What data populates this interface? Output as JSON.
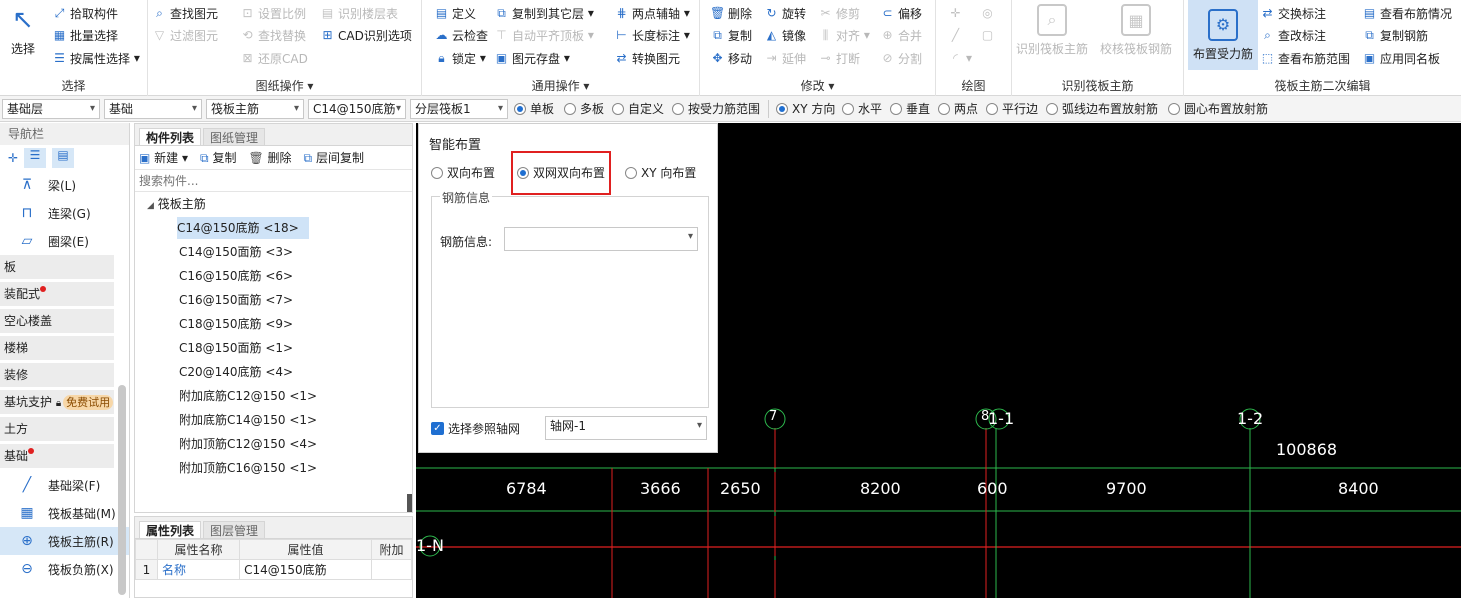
{
  "ribbon": {
    "select": {
      "label": "选择",
      "items": [
        "拾取构件",
        "批量选择",
        "按属性选择"
      ],
      "group": "选择"
    },
    "drawing": {
      "col1": [
        "查找图元",
        "过滤图元"
      ],
      "col2": [
        "设置比例",
        "查找替换",
        "还原CAD"
      ],
      "col3": [
        "识别楼层表",
        "CAD识别选项"
      ],
      "group": "图纸操作"
    },
    "general": {
      "col1": [
        "定义",
        "云检查",
        "锁定"
      ],
      "col2": [
        "复制到其它层",
        "自动平齐顶板",
        "图元存盘"
      ],
      "col3": [
        "两点辅轴",
        "长度标注",
        "转换图元"
      ],
      "group": "通用操作"
    },
    "modify": {
      "col1": [
        "删除",
        "复制",
        "移动"
      ],
      "col2": [
        "旋转",
        "镜像",
        "延伸"
      ],
      "col3": [
        "修剪",
        "对齐",
        "打断"
      ],
      "col4": [
        "偏移",
        "合并",
        "分割"
      ],
      "group": "修改"
    },
    "draw": {
      "group": "绘图"
    },
    "recog": {
      "btn1": "识别筏板主筋",
      "btn2": "校核筏板钢筋",
      "group": "识别筏板主筋"
    },
    "edit2": {
      "big": "布置受力筋",
      "col1": [
        "交换标注",
        "查改标注",
        "查看布筋范围"
      ],
      "col2": [
        "查看布筋情况",
        "复制钢筋",
        "应用同名板"
      ],
      "group": "筏板主筋二次编辑"
    }
  },
  "toolbar": {
    "selects": [
      "基础层",
      "基础",
      "筏板主筋",
      "C14@150底筋",
      "分层筏板1"
    ],
    "radios1": [
      "单板",
      "多板",
      "自定义",
      "按受力筋范围"
    ],
    "radios2": [
      "XY 方向",
      "水平",
      "垂直",
      "两点",
      "平行边",
      "弧线边布置放射筋",
      "圆心布置放射筋"
    ]
  },
  "nav": {
    "title": "导航栏",
    "top_items": [
      {
        "label": "梁(L)"
      },
      {
        "label": "连梁(G)"
      },
      {
        "label": "圈梁(E)"
      }
    ],
    "cats": [
      "板",
      "装配式",
      "空心楼盖",
      "楼梯",
      "装修",
      "基坑支护",
      "土方",
      "基础"
    ],
    "trial_badge": "免费试用",
    "bottom_items": [
      {
        "label": "基础梁(F)"
      },
      {
        "label": "筏板基础(M)"
      },
      {
        "label": "筏板主筋(R)"
      },
      {
        "label": "筏板负筋(X)"
      }
    ]
  },
  "comp": {
    "tabs": [
      "构件列表",
      "图纸管理"
    ],
    "actions": [
      "新建",
      "复制",
      "删除",
      "层间复制"
    ],
    "search_placeholder": "搜索构件...",
    "root": "筏板主筋",
    "items": [
      "C14@150底筋 <18>",
      "C14@150面筋 <3>",
      "C16@150底筋 <6>",
      "C16@150面筋 <7>",
      "C18@150底筋 <9>",
      "C18@150面筋 <1>",
      "C20@140底筋 <4>",
      "附加底筋C12@150 <1>",
      "附加底筋C14@150 <1>",
      "附加顶筋C12@150 <4>",
      "附加顶筋C16@150 <1>"
    ]
  },
  "prop": {
    "tabs": [
      "属性列表",
      "图层管理"
    ],
    "headers": [
      "属性名称",
      "属性值",
      "附加"
    ],
    "row": {
      "num": "1",
      "name": "名称",
      "value": "C14@150底筋"
    }
  },
  "dialog": {
    "title": "智能布置",
    "options": [
      "双向布置",
      "双网双向布置",
      "XY 向布置"
    ],
    "section": "钢筋信息",
    "field_label": "钢筋信息:",
    "check_label": "选择参照轴网",
    "axis_value": "轴网-1"
  },
  "canvas": {
    "axis_labels": [
      "7",
      "8",
      "1-1",
      "1-2",
      "1-N"
    ],
    "total": "100868",
    "dims": [
      "6784",
      "3666",
      "2650",
      "8200",
      "600",
      "9700",
      "8400"
    ]
  }
}
